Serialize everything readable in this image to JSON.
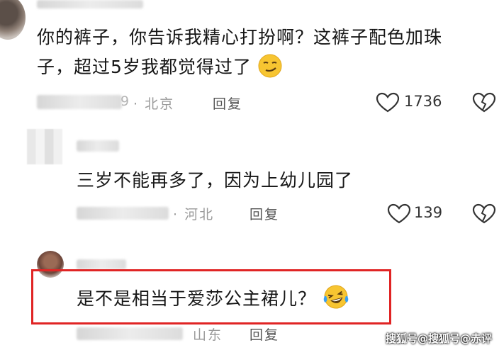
{
  "comments": [
    {
      "text_line1": "你的裤子，你告诉我精心打扮啊？这裤子配色加珠",
      "text_line2": "子，超过5岁我都觉得过了",
      "emoji": "smirk-emoji",
      "date_partial": "9",
      "location": "· 北京",
      "reply_label": "回复",
      "like_count": "1736"
    },
    {
      "text": "三岁不能再多了，因为上幼儿园了",
      "location": "· 河北",
      "reply_label": "回复",
      "like_count": "139"
    },
    {
      "text": "是不是相当于爱莎公主裙儿？",
      "emoji": "laughing-tears-emoji",
      "location": "山东",
      "reply_label": "回复"
    }
  ],
  "watermark": "搜狐号@搜狐号@赤评",
  "colors": {
    "highlight": "#e02424",
    "meta": "#9a9a9a"
  }
}
